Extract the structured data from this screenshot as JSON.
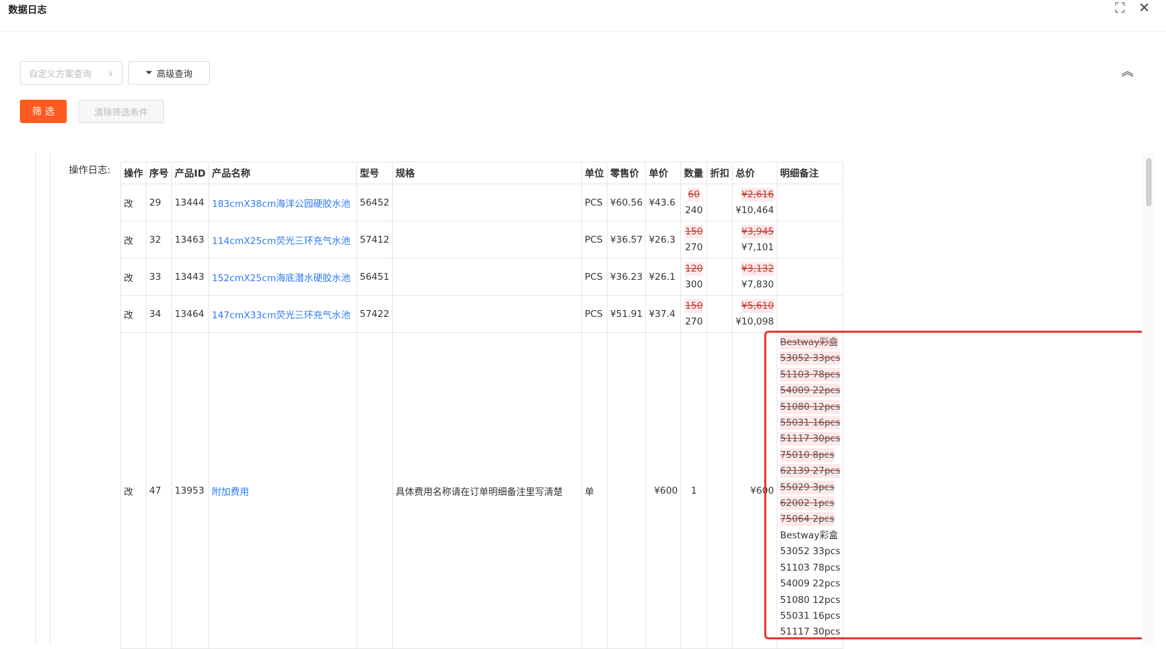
{
  "window": {
    "title": "数据日志"
  },
  "toolbar": {
    "scheme_placeholder": "自定义方案查询",
    "advanced_label": "高级查询",
    "filter_label": "筛 选",
    "clear_label": "清除筛选条件"
  },
  "log": {
    "label": "操作日志:",
    "columns": [
      "操作",
      "序号",
      "产品ID",
      "产品名称",
      "型号",
      "规格",
      "单位",
      "零售价",
      "单价",
      "数量",
      "折扣",
      "总价",
      "明细备注"
    ],
    "rows": [
      {
        "op": "改",
        "seq": "29",
        "pid": "13444",
        "name": "183cmX38cm海洋公园硬胶水池",
        "model": "56452",
        "spec": "",
        "unit": "PCS",
        "retail": "¥60.56",
        "price": "¥43.6",
        "qty_old": "60",
        "qty_new": "240",
        "discount": "",
        "total_old": "¥2,616",
        "total_new": "¥10,464"
      },
      {
        "op": "改",
        "seq": "32",
        "pid": "13463",
        "name": "114cmX25cm荧光三环充气水池",
        "model": "57412",
        "spec": "",
        "unit": "PCS",
        "retail": "¥36.57",
        "price": "¥26.3",
        "qty_old": "150",
        "qty_new": "270",
        "discount": "",
        "total_old": "¥3,945",
        "total_new": "¥7,101"
      },
      {
        "op": "改",
        "seq": "33",
        "pid": "13443",
        "name": "152cmX25cm海底潜水硬胶水池",
        "model": "56451",
        "spec": "",
        "unit": "PCS",
        "retail": "¥36.23",
        "price": "¥26.1",
        "qty_old": "120",
        "qty_new": "300",
        "discount": "",
        "total_old": "¥3,132",
        "total_new": "¥7,830"
      },
      {
        "op": "改",
        "seq": "34",
        "pid": "13464",
        "name": "147cmX33cm荧光三环充气水池",
        "model": "57422",
        "spec": "",
        "unit": "PCS",
        "retail": "¥51.91",
        "price": "¥37.4",
        "qty_old": "150",
        "qty_new": "270",
        "discount": "",
        "total_old": "¥5,610",
        "total_new": "¥10,098"
      }
    ],
    "big_row": {
      "op": "改",
      "seq": "47",
      "pid": "13953",
      "name": "附加费用",
      "model": "",
      "spec": "具体费用名称请在订单明细备注里写清楚",
      "unit": "单",
      "retail": "",
      "price": "¥600",
      "qty": "1",
      "discount": "",
      "total": "¥600",
      "notes_old": [
        "Bestway彩盒",
        "53052 33pcs",
        "51103 78pcs",
        "54009 22pcs",
        "51080 12pcs",
        "55031 16pcs",
        "51117 30pcs",
        "75010 8pcs",
        "62139 27pcs",
        "55029 3pcs",
        "62002 1pcs",
        "75064 2pcs"
      ],
      "notes_new": [
        "Bestway彩盒",
        "53052 33pcs",
        "51103 78pcs",
        "54009 22pcs",
        "51080 12pcs",
        "55031 16pcs",
        "51117 30pcs"
      ]
    }
  },
  "icons": {
    "fullscreen": "fullscreen-icon",
    "close": "close-icon",
    "filter": "funnel-icon",
    "collapse": "double-chevron-up-icon",
    "dropdown": "chevron-down-icon"
  },
  "colors": {
    "primary": "#ff5a1f",
    "link": "#2f7bf0",
    "deleted": "#c0392b",
    "highlight": "#e03b2e"
  }
}
